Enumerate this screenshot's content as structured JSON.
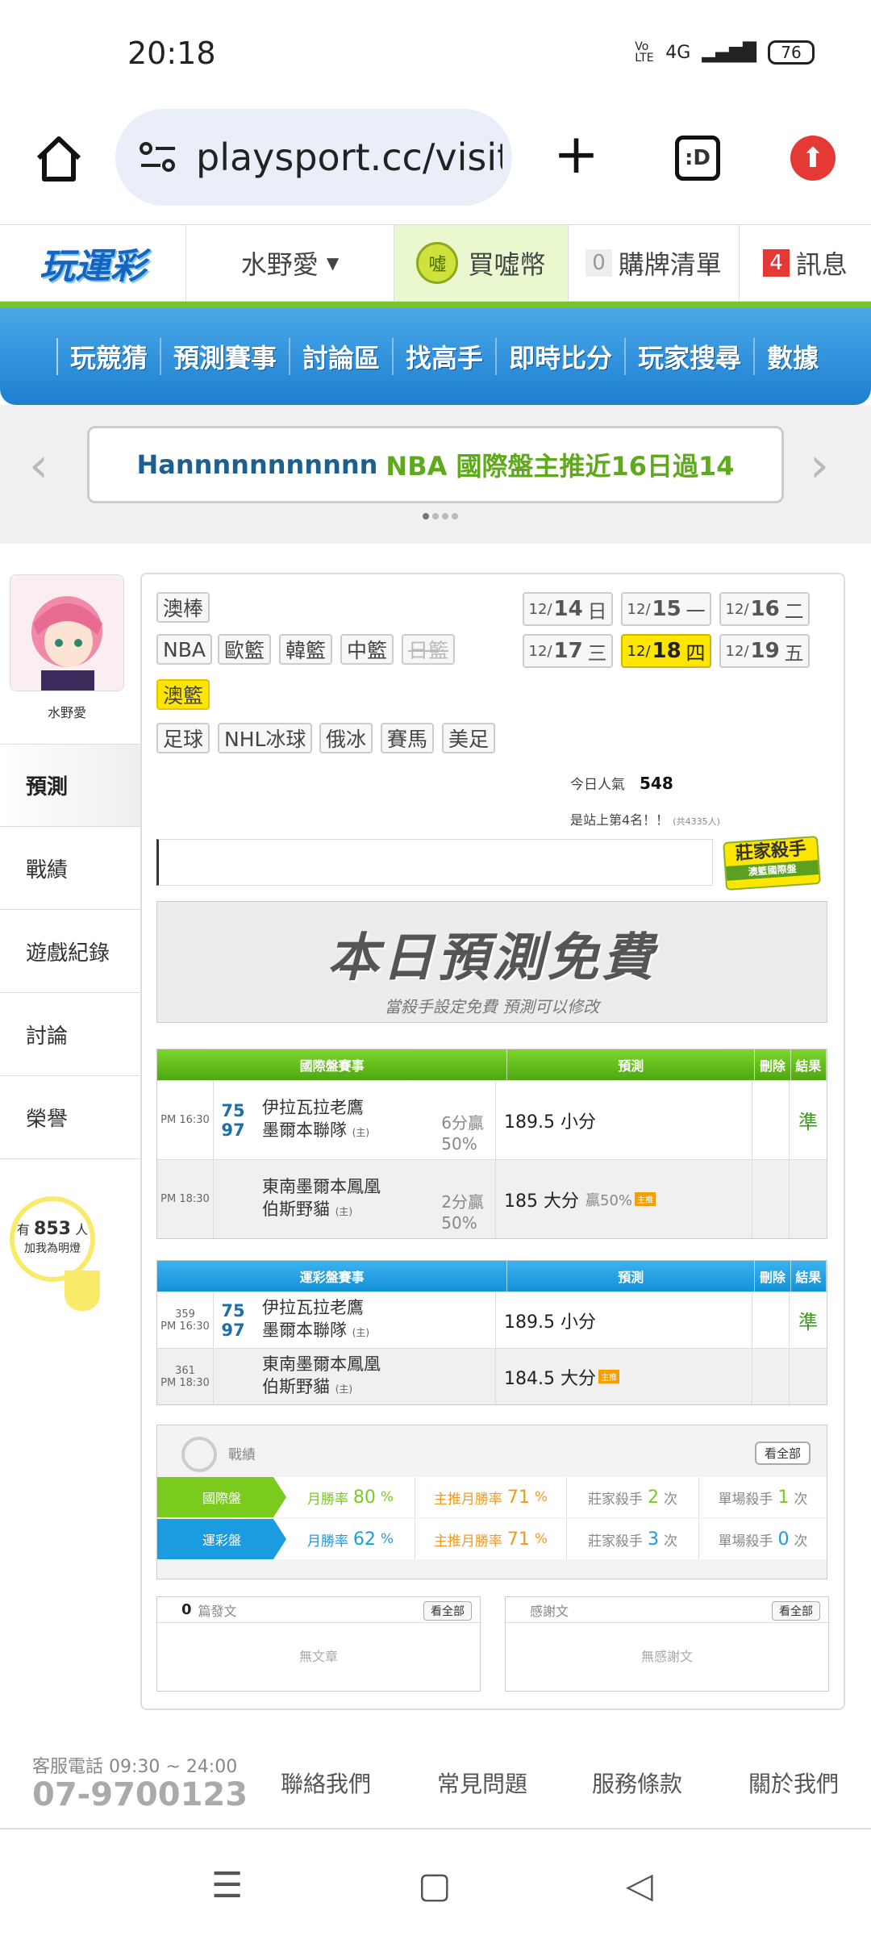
{
  "status": {
    "time": "20:18",
    "network": "4G",
    "volte": "Vo LTE",
    "battery": "76"
  },
  "browser": {
    "url": "playsport.cc/visit",
    "tab_glyph": ":D"
  },
  "site_header": {
    "logo": "玩運彩",
    "user": "水野愛",
    "buy_coin": "買噓幣",
    "coin_icon_text": "噓",
    "cart_count": "0",
    "cart_label": "購牌清單",
    "msg_count": "4",
    "msg_label": "訊息"
  },
  "nav": [
    "玩競猜",
    "預測賽事",
    "討論區",
    "找高手",
    "即時比分",
    "玩家搜尋",
    "數據"
  ],
  "banner": {
    "name": "Hannnnnnnnnnn",
    "text": "NBA 國際盤主推近16日過14"
  },
  "profile": {
    "name": "水野愛",
    "fans_prefix": "有",
    "fans_count": "853",
    "fans_unit": "人",
    "fans_suffix": "加我為明燈"
  },
  "side_menu": [
    "預測",
    "戰績",
    "遊戲紀錄",
    "討論",
    "榮譽"
  ],
  "league_tags": [
    "澳棒",
    "NBA",
    "歐籃",
    "韓籃",
    "中籃",
    "日籃",
    "澳籃",
    "足球",
    "NHL冰球",
    "俄冰",
    "賽馬",
    "美足"
  ],
  "dates": [
    {
      "m": "12/",
      "d": "14",
      "w": "日"
    },
    {
      "m": "12/",
      "d": "15",
      "w": "一"
    },
    {
      "m": "12/",
      "d": "16",
      "w": "二"
    },
    {
      "m": "12/",
      "d": "17",
      "w": "三"
    },
    {
      "m": "12/",
      "d": "18",
      "w": "四"
    },
    {
      "m": "12/",
      "d": "19",
      "w": "五"
    }
  ],
  "popularity": {
    "label": "今日人氣",
    "value": "548",
    "rank_text": "是站上第4名！！",
    "rank_total": "(共4335人)"
  },
  "killer_badge": {
    "title": "莊家殺手",
    "sub": "澳籃國際盤"
  },
  "free": {
    "title": "本日預測免費",
    "subtitle": "當殺手設定免費  預測可以修改"
  },
  "intl_table": {
    "headers": [
      "國際盤賽事",
      "預測",
      "刪除",
      "結果"
    ],
    "rows": [
      {
        "time": "PM 16:30",
        "s1": "75",
        "s2": "97",
        "t1": "伊拉瓦拉老鷹",
        "t2": "墨爾本聯隊",
        "home": "(主)",
        "odds1": "6分贏",
        "odds2": "50%",
        "pred": "189.5 小分",
        "win": "",
        "res": "準"
      },
      {
        "time": "PM 18:30",
        "s1": "",
        "s2": "",
        "t1": "東南墨爾本鳳凰",
        "t2": "伯斯野貓",
        "home": "(主)",
        "odds1": "2分贏",
        "odds2": "50%",
        "pred": "185 大分",
        "win": "贏50%",
        "res": ""
      }
    ]
  },
  "lottery_table": {
    "headers": [
      "運彩盤賽事",
      "預測",
      "刪除",
      "結果"
    ],
    "rows": [
      {
        "no": "359",
        "time": "PM 16:30",
        "s1": "75",
        "s2": "97",
        "t1": "伊拉瓦拉老鷹",
        "t2": "墨爾本聯隊",
        "home": "(主)",
        "pred": "189.5 小分",
        "res": "準"
      },
      {
        "no": "361",
        "time": "PM 18:30",
        "s1": "",
        "s2": "",
        "t1": "東南墨爾本鳳凰",
        "t2": "伯斯野貓",
        "home": "(主)",
        "pred": "184.5 大分",
        "res": ""
      }
    ]
  },
  "record": {
    "title": "戰績",
    "view_all": "看全部",
    "rows": [
      {
        "label": "國際盤",
        "wr_label": "月勝率",
        "wr": "80",
        "main_label": "主推月勝率",
        "main": "71",
        "pct": "%",
        "kill_label": "莊家殺手",
        "kill": "2",
        "single_label": "單場殺手",
        "single": "1",
        "times": "次",
        "color": "#7acb1e"
      },
      {
        "label": "運彩盤",
        "wr_label": "月勝率",
        "wr": "62",
        "main_label": "主推月勝率",
        "main": "71",
        "pct": "%",
        "kill_label": "莊家殺手",
        "kill": "3",
        "single_label": "單場殺手",
        "single": "0",
        "times": "次",
        "color": "#1b9be0"
      }
    ]
  },
  "posts": {
    "count": "0",
    "label": "篇發文",
    "view_all": "看全部",
    "empty": "無文章"
  },
  "thanks": {
    "label": "感謝文",
    "view_all": "看全部",
    "empty": "無感謝文"
  },
  "footer": {
    "phone_label": "客服電話 09:30 ~ 24:00",
    "phone": "07-9700123",
    "links": [
      "聯絡我們",
      "常見問題",
      "服務條款",
      "關於我們"
    ]
  }
}
